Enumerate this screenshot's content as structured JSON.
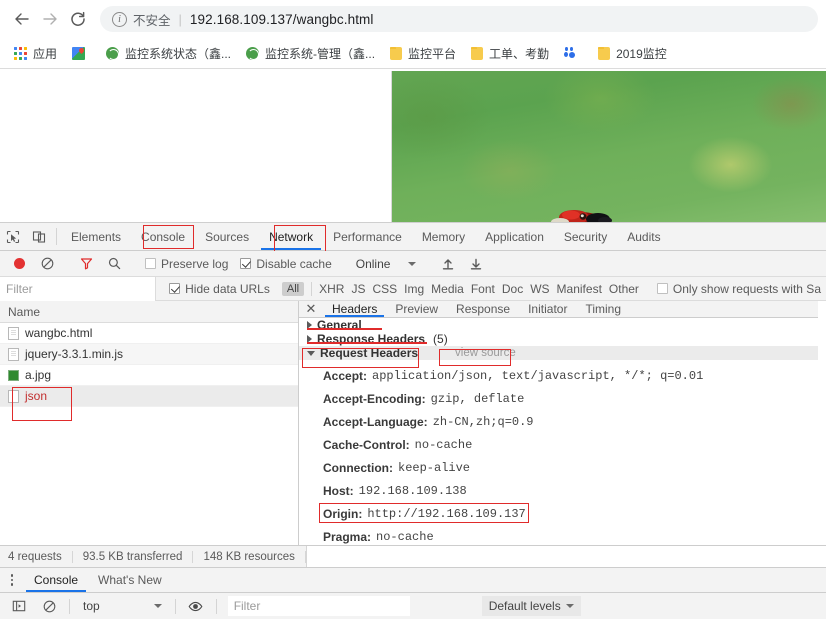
{
  "browser": {
    "nav": {
      "back": "back-arrow",
      "forward": "forward-arrow",
      "reload": "reload"
    },
    "omnibox": {
      "security_label": "不安全",
      "url": "192.168.109.137/wangbc.html",
      "info_glyph": "i"
    },
    "bookmarks": [
      {
        "icon": "apps-grid-icon",
        "label": "应用"
      },
      {
        "icon": "maps-icon",
        "label": ""
      },
      {
        "icon": "globe-icon",
        "label": "监控系统状态（鑫..."
      },
      {
        "icon": "globe-icon",
        "label": "监控系统-管理（鑫..."
      },
      {
        "icon": "folder-icon",
        "label": "监控平台"
      },
      {
        "icon": "folder-icon",
        "label": "工单、考勤"
      },
      {
        "icon": "baidu-icon",
        "label": ""
      },
      {
        "icon": "folder-icon",
        "label": "2019监控"
      }
    ]
  },
  "devtools": {
    "main_tabs": [
      {
        "label": "Elements",
        "active": false
      },
      {
        "label": "Console",
        "active": false
      },
      {
        "label": "Sources",
        "active": false
      },
      {
        "label": "Network",
        "active": true
      },
      {
        "label": "Performance",
        "active": false
      },
      {
        "label": "Memory",
        "active": false
      },
      {
        "label": "Application",
        "active": false
      },
      {
        "label": "Security",
        "active": false
      },
      {
        "label": "Audits",
        "active": false
      }
    ],
    "toolbar": {
      "record_title": "record-button",
      "clear_title": "clear-button",
      "filter_title": "filter-button",
      "search_title": "search-button",
      "preserve_log": "Preserve log",
      "preserve_log_checked": false,
      "disable_cache": "Disable cache",
      "disable_cache_checked": true,
      "throttling": "Online",
      "import_title": "import-har",
      "export_title": "export-har"
    },
    "filterbar": {
      "filter_placeholder": "Filter",
      "hide_data_urls": "Hide data URLs",
      "hide_data_urls_checked": true,
      "types": [
        "All",
        "XHR",
        "JS",
        "CSS",
        "Img",
        "Media",
        "Font",
        "Doc",
        "WS",
        "Manifest",
        "Other"
      ],
      "active_type": "All",
      "blocked_cookies": "Only show requests with Sa"
    },
    "requests": {
      "column_header": "Name",
      "rows": [
        {
          "name": "wangbc.html",
          "icon": "document-icon",
          "selected": false
        },
        {
          "name": "jquery-3.3.1.min.js",
          "icon": "document-icon",
          "selected": false
        },
        {
          "name": "a.jpg",
          "icon": "image-icon",
          "selected": false
        },
        {
          "name": "json",
          "icon": "blank-document-icon",
          "selected": true
        }
      ]
    },
    "detail_tabs": [
      {
        "label": "Headers",
        "active": true
      },
      {
        "label": "Preview",
        "active": false
      },
      {
        "label": "Response",
        "active": false
      },
      {
        "label": "Initiator",
        "active": false
      },
      {
        "label": "Timing",
        "active": false
      }
    ],
    "sections": {
      "general": {
        "title": "General",
        "count": "",
        "expanded": false
      },
      "response_headers": {
        "title": "Response Headers",
        "count": "(5)",
        "expanded": false
      },
      "request_headers": {
        "title": "Request Headers",
        "count": "",
        "expanded": true,
        "view_source": "view source"
      }
    },
    "request_headers": [
      {
        "key": "Accept:",
        "value": "application/json, text/javascript, */*; q=0.01",
        "highlight": false
      },
      {
        "key": "Accept-Encoding:",
        "value": "gzip, deflate",
        "highlight": false
      },
      {
        "key": "Accept-Language:",
        "value": "zh-CN,zh;q=0.9",
        "highlight": false
      },
      {
        "key": "Cache-Control:",
        "value": "no-cache",
        "highlight": false
      },
      {
        "key": "Connection:",
        "value": "keep-alive",
        "highlight": false
      },
      {
        "key": "Host:",
        "value": "192.168.109.138",
        "highlight": false
      },
      {
        "key": "Origin:",
        "value": "http://192.168.109.137",
        "highlight": true
      },
      {
        "key": "Pragma:",
        "value": "no-cache",
        "highlight": false
      }
    ],
    "status": {
      "requests": "4 requests",
      "transferred": "93.5 KB transferred",
      "resources": "148 KB resources"
    }
  },
  "drawer": {
    "tabs": [
      {
        "label": "Console",
        "active": true
      },
      {
        "label": "What's New",
        "active": false
      }
    ],
    "toolbar": {
      "sidebar_title": "console-sidebar-toggle",
      "clear_title": "clear-console",
      "context": "top",
      "eye_title": "live-expression",
      "filter_placeholder": "Filter",
      "levels": "Default levels"
    }
  },
  "annotations": {
    "color": "#e02b2b",
    "boxes": [
      "console-tab",
      "network-tab",
      "json-request-row",
      "request-headers-section",
      "view-source-link",
      "origin-header-row"
    ],
    "underlines": [
      "general-section",
      "response-headers-section"
    ]
  }
}
